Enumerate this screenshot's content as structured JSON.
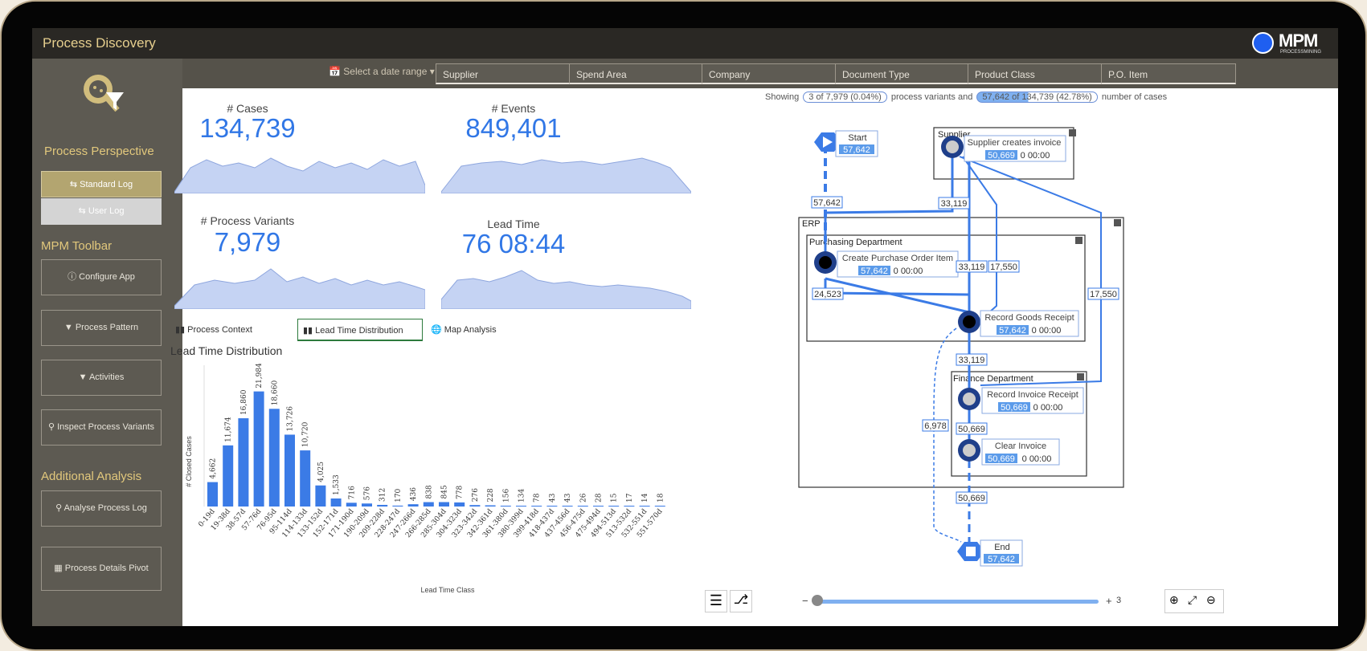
{
  "app": {
    "title": "Process Discovery",
    "logo_text": "MPM",
    "logo_sub": "PROCESSMINING"
  },
  "filters": {
    "date_range": "Select a date range",
    "fields": [
      "Supplier",
      "Spend Area",
      "Company",
      "Document Type",
      "Product Class",
      "P.O. Item"
    ]
  },
  "sidebar": {
    "perspective_heading": "Process Perspective",
    "standard_log": "Standard Log",
    "user_log": "User Log",
    "toolbar_heading": "MPM Toolbar",
    "configure_app": "Configure App",
    "process_pattern": "Process Pattern",
    "activities": "Activities",
    "inspect_variants": "Inspect Process Variants",
    "additional_heading": "Additional Analysis",
    "analyse_log": "Analyse Process Log",
    "details_pivot": "Process Details Pivot"
  },
  "kpis": {
    "cases_label": "# Cases",
    "cases_value": "134,739",
    "events_label": "# Events",
    "events_value": "849,401",
    "variants_label": "# Process Variants",
    "variants_value": "7,979",
    "leadtime_label": "Lead Time",
    "leadtime_value": "76 08:44"
  },
  "tabs": [
    "Process Context",
    "Lead Time Distribution",
    "Map Analysis"
  ],
  "chart_title": "Lead Time Distribution",
  "chart_data": {
    "type": "bar",
    "xlabel": "Lead Time Class",
    "ylabel": "# Closed Cases",
    "categories": [
      "0-19d",
      "19-38d",
      "38-57d",
      "57-76d",
      "76-95d",
      "95-114d",
      "114-133d",
      "133-152d",
      "152-171d",
      "171-190d",
      "190-209d",
      "209-228d",
      "228-247d",
      "247-266d",
      "266-285d",
      "285-304d",
      "304-323d",
      "323-342d",
      "342-361d",
      "361-380d",
      "380-399d",
      "399-418d",
      "418-437d",
      "437-456d",
      "456-475d",
      "475-494d",
      "494-513d",
      "513-532d",
      "532-551d",
      "551-570d"
    ],
    "values": [
      4662,
      11674,
      16860,
      21984,
      18660,
      13726,
      10720,
      4025,
      1533,
      716,
      576,
      312,
      170,
      436,
      838,
      845,
      778,
      276,
      228,
      156,
      134,
      78,
      43,
      43,
      26,
      28,
      15,
      17,
      14,
      18
    ],
    "ylim": [
      0,
      23000
    ],
    "grid": false
  },
  "map": {
    "showing_prefix": "Showing",
    "variants_pill": "3 of 7,979 (0.04%)",
    "variants_text": "process variants and",
    "cases_pill": "57,642 of 134,739 (42.78%)",
    "cases_text": "number of cases",
    "start_label": "Start",
    "start_count": "57,642",
    "end_label": "End",
    "end_count": "57,642",
    "supplier_group": "Supplier",
    "erp_group": "ERP",
    "purchasing_group": "Purchasing Department",
    "finance_group": "Finance Department",
    "act_supplier_invoice": "Supplier creates invoice",
    "act_supplier_invoice_count": "50,669",
    "act_supplier_invoice_time": "0 00:00",
    "act_create_po": "Create Purchase Order Item",
    "act_create_po_count": "57,642",
    "act_create_po_time": "0 00:00",
    "act_goods_receipt": "Record Goods Receipt",
    "act_goods_receipt_count": "57,642",
    "act_goods_receipt_time": "0 00:00",
    "act_invoice_receipt": "Record Invoice Receipt",
    "act_invoice_receipt_count": "50,669",
    "act_invoice_receipt_time": "0 00:00",
    "act_clear_invoice": "Clear Invoice",
    "act_clear_invoice_count": "50,669",
    "act_clear_invoice_time": "0 00:00",
    "edge_57642": "57,642",
    "edge_33119a": "33,119",
    "edge_33119b": "33,119",
    "edge_17550a": "17,550",
    "edge_17550b": "17,550",
    "edge_24523": "24,523",
    "edge_33119c": "33,119",
    "edge_6978": "6,978",
    "edge_50669a": "50,669",
    "edge_50669b": "50,669",
    "slider_minus": "−",
    "slider_plus": "+",
    "slider_value": "3"
  }
}
